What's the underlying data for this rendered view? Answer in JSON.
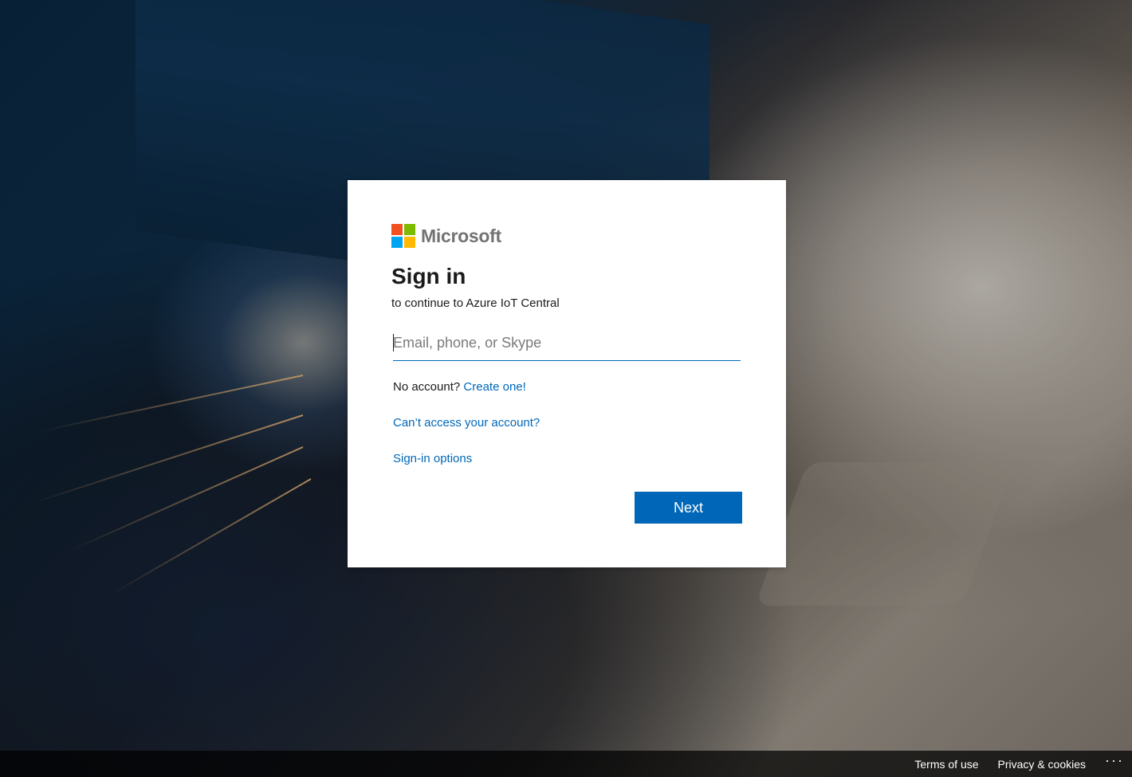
{
  "brand": {
    "name": "Microsoft",
    "logo_colors": [
      "#f25022",
      "#7fba00",
      "#00a4ef",
      "#ffb900"
    ]
  },
  "signin": {
    "title": "Sign in",
    "subtitle": "to continue to Azure IoT Central",
    "email_placeholder": "Email, phone, or Skype",
    "email_value": "",
    "no_account_text": "No account?",
    "create_link": "Create one!",
    "cant_access_link": "Can’t access your account?",
    "signin_options_link": "Sign-in options",
    "next_label": "Next"
  },
  "footer": {
    "terms": "Terms of use",
    "privacy": "Privacy & cookies",
    "more": "···"
  },
  "colors": {
    "accent": "#0067b8",
    "text": "#1b1b1b",
    "logo_text": "#737373"
  }
}
